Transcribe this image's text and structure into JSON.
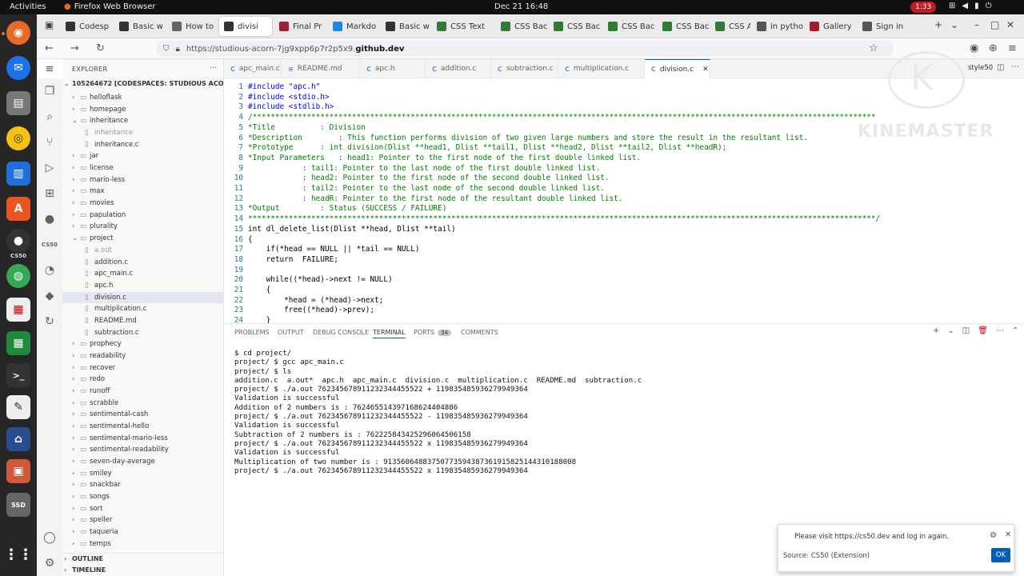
{
  "topbar": {
    "activities": "Activities",
    "app_name": "Firefox Web Browser",
    "clock": "Dec 21  16:48",
    "badge": "1:33"
  },
  "browser": {
    "tabs": [
      {
        "label": "Codesp",
        "icon_color": "#333"
      },
      {
        "label": "Basic w",
        "icon_color": "#333"
      },
      {
        "label": "How to",
        "icon_color": "#666"
      },
      {
        "label": "divisi",
        "icon_color": "#333"
      },
      {
        "label": "Final Pr",
        "icon_color": "#a51c30"
      },
      {
        "label": "Markdo",
        "icon_color": "#1e88e5"
      },
      {
        "label": "Basic w",
        "icon_color": "#333"
      },
      {
        "label": "CSS Text",
        "icon_color": "#2e7d32"
      },
      {
        "label": "CSS Bac",
        "icon_color": "#2e7d32"
      },
      {
        "label": "CSS Bac",
        "icon_color": "#2e7d32"
      },
      {
        "label": "CSS Bac",
        "icon_color": "#2e7d32"
      },
      {
        "label": "CSS Bac",
        "icon_color": "#2e7d32"
      },
      {
        "label": "CSS Att",
        "icon_color": "#2e7d32"
      },
      {
        "label": "in pytho",
        "icon_color": "#555"
      },
      {
        "label": "Gallery",
        "icon_color": "#a51c30"
      },
      {
        "label": "Sign in",
        "icon_color": "#555"
      }
    ],
    "url_prefix": "https://studious-acorn-7jg9xpp6p7r2p5x9.",
    "url_host": "github.dev"
  },
  "explorer": {
    "title": "EXPLORER",
    "root": "105264672 [CODESPACES: STUDIOUS ACORN]",
    "items": [
      {
        "label": "helloflask",
        "type": "folder",
        "indent": 1
      },
      {
        "label": "homepage",
        "type": "folder",
        "indent": 1
      },
      {
        "label": "inheritance",
        "type": "folder-open",
        "indent": 1
      },
      {
        "label": "inheritance",
        "type": "file-dim",
        "indent": 2
      },
      {
        "label": "inheritance.c",
        "type": "file",
        "indent": 2
      },
      {
        "label": "jar",
        "type": "folder",
        "indent": 1
      },
      {
        "label": "license",
        "type": "folder",
        "indent": 1
      },
      {
        "label": "mario-less",
        "type": "folder",
        "indent": 1
      },
      {
        "label": "max",
        "type": "folder",
        "indent": 1
      },
      {
        "label": "movies",
        "type": "folder",
        "indent": 1
      },
      {
        "label": "papulation",
        "type": "folder",
        "indent": 1
      },
      {
        "label": "plurality",
        "type": "folder",
        "indent": 1
      },
      {
        "label": "project",
        "type": "folder-open",
        "indent": 1
      },
      {
        "label": "a.out",
        "type": "file-dim",
        "indent": 2
      },
      {
        "label": "addition.c",
        "type": "file",
        "indent": 2
      },
      {
        "label": "apc_main.c",
        "type": "file",
        "indent": 2
      },
      {
        "label": "apc.h",
        "type": "file",
        "indent": 2
      },
      {
        "label": "division.c",
        "type": "file-selected",
        "indent": 2
      },
      {
        "label": "multiplication.c",
        "type": "file",
        "indent": 2
      },
      {
        "label": "README.md",
        "type": "file",
        "indent": 2
      },
      {
        "label": "subtraction.c",
        "type": "file",
        "indent": 2
      },
      {
        "label": "prophecy",
        "type": "folder",
        "indent": 1
      },
      {
        "label": "readability",
        "type": "folder",
        "indent": 1
      },
      {
        "label": "recover",
        "type": "folder",
        "indent": 1
      },
      {
        "label": "redo",
        "type": "folder",
        "indent": 1
      },
      {
        "label": "runoff",
        "type": "folder",
        "indent": 1
      },
      {
        "label": "scrabble",
        "type": "folder",
        "indent": 1
      },
      {
        "label": "sentimental-cash",
        "type": "folder",
        "indent": 1
      },
      {
        "label": "sentimental-hello",
        "type": "folder",
        "indent": 1
      },
      {
        "label": "sentimental-mario-less",
        "type": "folder",
        "indent": 1
      },
      {
        "label": "sentimental-readability",
        "type": "folder",
        "indent": 1
      },
      {
        "label": "seven-day-average",
        "type": "folder",
        "indent": 1
      },
      {
        "label": "smiley",
        "type": "folder",
        "indent": 1
      },
      {
        "label": "snackbar",
        "type": "folder",
        "indent": 1
      },
      {
        "label": "songs",
        "type": "folder",
        "indent": 1
      },
      {
        "label": "sort",
        "type": "folder",
        "indent": 1
      },
      {
        "label": "speller",
        "type": "folder",
        "indent": 1
      },
      {
        "label": "taqueria",
        "type": "folder",
        "indent": 1
      },
      {
        "label": "temps",
        "type": "folder",
        "indent": 1
      }
    ],
    "outline": "OUTLINE",
    "timeline": "TIMELINE"
  },
  "editor": {
    "tabs": [
      {
        "label": "apc_main.c",
        "active": false
      },
      {
        "label": "README.md",
        "active": false
      },
      {
        "label": "apc.h",
        "active": false
      },
      {
        "label": "addition.c",
        "active": false
      },
      {
        "label": "subtraction.c",
        "active": false
      },
      {
        "label": "multiplication.c",
        "active": false
      },
      {
        "label": "division.c",
        "active": true
      }
    ],
    "right_label": "style50",
    "lines": [
      {
        "n": "1",
        "text": "#include \"apc.h\"",
        "kind": "pp"
      },
      {
        "n": "2",
        "text": "#include <stdio.h>",
        "kind": "pp"
      },
      {
        "n": "3",
        "text": "#include <stdlib.h>",
        "kind": "pp"
      },
      {
        "n": "4",
        "text": "/******************************************************************************************************************************************",
        "kind": "cm"
      },
      {
        "n": "5",
        "text": "*Title          : Division",
        "kind": "cm"
      },
      {
        "n": "6",
        "text": "*Description        : This function performs division of two given large numbers and store the result in the resultant list.",
        "kind": "cm"
      },
      {
        "n": "7",
        "text": "*Prototype      : int division(Dlist **head1, Dlist **tail1, Dlist **head2, Dlist **tail2, Dlist **headR);",
        "kind": "cm"
      },
      {
        "n": "8",
        "text": "*Input Parameters   : head1: Pointer to the first node of the first double linked list.",
        "kind": "cm"
      },
      {
        "n": "9",
        "text": "            : tail1: Pointer to the last node of the first double linked list.",
        "kind": "cm"
      },
      {
        "n": "10",
        "text": "            : head2: Pointer to the first node of the second double linked list.",
        "kind": "cm"
      },
      {
        "n": "11",
        "text": "            : tail2: Pointer to the last node of the second double linked list.",
        "kind": "cm"
      },
      {
        "n": "12",
        "text": "            : headR: Pointer to the first node of the resultant double linked list.",
        "kind": "cm"
      },
      {
        "n": "13",
        "text": "*Output         : Status (SUCCESS / FAILURE)",
        "kind": "cm"
      },
      {
        "n": "14",
        "text": "*******************************************************************************************************************************************/",
        "kind": "cm"
      },
      {
        "n": "15",
        "text": "int dl_delete_list(Dlist **head, Dlist **tail)",
        "kind": "code"
      },
      {
        "n": "16",
        "text": "{",
        "kind": "code"
      },
      {
        "n": "17",
        "text": "    if(*head == NULL || *tail == NULL)",
        "kind": "code"
      },
      {
        "n": "18",
        "text": "    return  FAILURE;",
        "kind": "code"
      },
      {
        "n": "19",
        "text": "",
        "kind": "code"
      },
      {
        "n": "20",
        "text": "    while((*head)->next != NULL)",
        "kind": "code"
      },
      {
        "n": "21",
        "text": "    {",
        "kind": "code"
      },
      {
        "n": "22",
        "text": "        *head = (*head)->next;",
        "kind": "code"
      },
      {
        "n": "23",
        "text": "        free((*head)->prev);",
        "kind": "code"
      },
      {
        "n": "24",
        "text": "    }",
        "kind": "code"
      }
    ]
  },
  "panel": {
    "tabs": [
      "PROBLEMS",
      "OUTPUT",
      "DEBUG CONSOLE",
      "TERMINAL",
      "PORTS",
      "COMMENTS"
    ],
    "active_tab": "TERMINAL",
    "ports_count": "34",
    "terminal": [
      "$ cd project/",
      "project/ $ gcc apc_main.c",
      "project/ $ ls",
      "addition.c  a.out*  apc.h  apc_main.c  division.c  multiplication.c  README.md  subtraction.c",
      "project/ $ ./a.out 762345678911232344455522 + 119835485936279949364",
      "Validation is successful",
      "Addition of 2 numbers is : 762465514397168624404886",
      "project/ $ ./a.out 762345678911232344455522 - 119835485936279949364",
      "Validation is successful",
      "Subtraction of 2 numbers is : 762225843425296064506158",
      "project/ $ ./a.out 762345678911232344455522 x 119835485936279949364",
      "Validation is successful",
      "Multiplication of two number is : 91356064883750773594387361915825144310188008",
      "project/ $ ./a.out 762345678911232344455522 x 119835485936279949364"
    ]
  },
  "notification": {
    "message": "Please visit https://cs50.dev and log in again.",
    "source": "Source: CS50 (Extension)",
    "ok": "OK"
  },
  "watermark": {
    "letter": "K",
    "text": "KINEMASTER"
  },
  "colors": {
    "accent": "#005fb8",
    "comment": "#008000",
    "keyword": "#0000ff",
    "line_number": "#237893",
    "dock_bg": "#262626",
    "topbar_bg": "#111111",
    "badge_red": "#c01c28"
  },
  "icons": {
    "dock": [
      "chromium-icon",
      "thunderbird-icon",
      "files-icon",
      "rhythmbox-icon",
      "writer-icon",
      "software-icon",
      "github-icon",
      "cs50-icon",
      "chrome-icon",
      "document-icon",
      "calc-icon",
      "terminal-icon",
      "text-editor-icon",
      "network-icon",
      "impress-icon",
      "ssd-icon",
      "apps-grid-icon"
    ]
  }
}
